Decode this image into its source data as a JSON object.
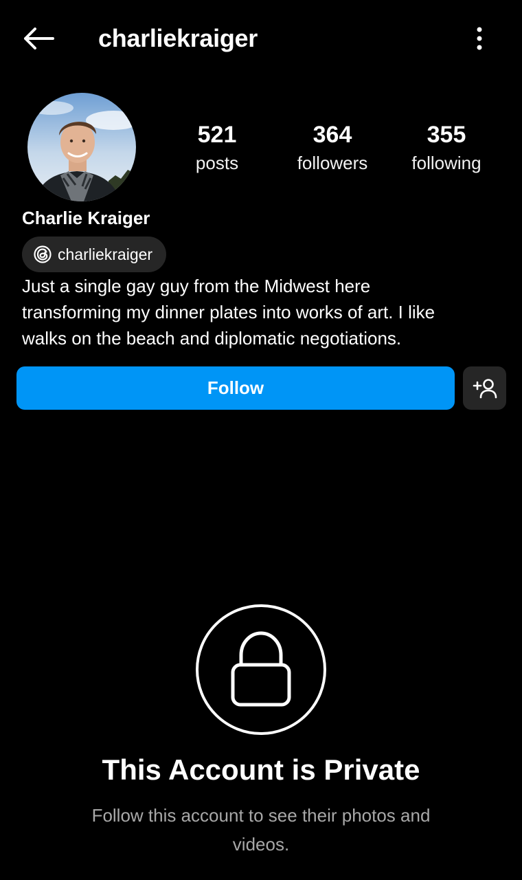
{
  "header": {
    "username": "charliekraiger",
    "back_icon": "arrow-left-icon",
    "more_icon": "more-vertical-icon"
  },
  "profile": {
    "avatar_icon": "profile-photo",
    "stats": [
      {
        "value": "521",
        "label": "posts"
      },
      {
        "value": "364",
        "label": "followers"
      },
      {
        "value": "355",
        "label": "following"
      }
    ],
    "display_name": "Charlie Kraiger",
    "threads_handle": "charliekraiger",
    "threads_icon": "threads-icon",
    "bio": "Just a single gay guy from the Midwest here\ntransforming my dinner plates into works of art. I like\nwalks on the beach and diplomatic negotiations."
  },
  "actions": {
    "follow_label": "Follow",
    "suggest_icon": "add-person-icon"
  },
  "private_notice": {
    "icon": "lock-icon",
    "title": "This Account is Private",
    "subtitle": "Follow this account to see their photos and videos."
  },
  "colors": {
    "background": "#000000",
    "follow_button": "#0095f6",
    "secondary_button": "#262626",
    "muted_text": "#a8a8a8"
  }
}
